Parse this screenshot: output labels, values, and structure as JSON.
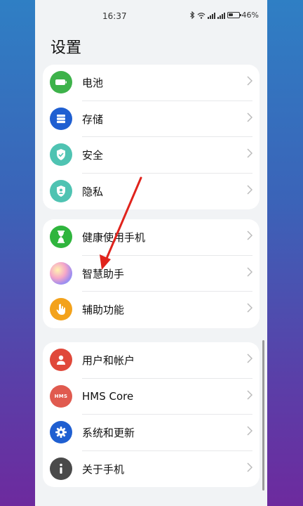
{
  "status": {
    "time": "16:37",
    "battery_text": "46%",
    "battery_level": 0.46,
    "net1": "4G",
    "net2": "4G"
  },
  "page": {
    "title": "设置"
  },
  "groups": [
    [
      {
        "label": "电池",
        "icon": "battery-icon",
        "color": "#3db24a"
      },
      {
        "label": "存储",
        "icon": "storage-icon",
        "color": "#1f5fd1"
      },
      {
        "label": "安全",
        "icon": "shield-check-icon",
        "color": "#4fc3b2"
      },
      {
        "label": "隐私",
        "icon": "privacy-shield-icon",
        "color": "#4fc3b2"
      }
    ],
    [
      {
        "label": "健康使用手机",
        "icon": "hourglass-icon",
        "color": "#2fb53d"
      },
      {
        "label": "智慧助手",
        "icon": "assistant-orb-icon",
        "color": "gradient"
      },
      {
        "label": "辅助功能",
        "icon": "hand-icon",
        "color": "#f3a21b"
      }
    ],
    [
      {
        "label": "用户和帐户",
        "icon": "user-icon",
        "color": "#e0483a"
      },
      {
        "label": "HMS Core",
        "icon": "hms-icon",
        "color": "#e05a4f",
        "icon_text": "HMS"
      },
      {
        "label": "系统和更新",
        "icon": "gear-icon",
        "color": "#1f5fd1"
      },
      {
        "label": "关于手机",
        "icon": "info-icon",
        "color": "#4a4a4a"
      }
    ]
  ],
  "annotation": {
    "type": "red-arrow",
    "color": "#e0231c"
  }
}
